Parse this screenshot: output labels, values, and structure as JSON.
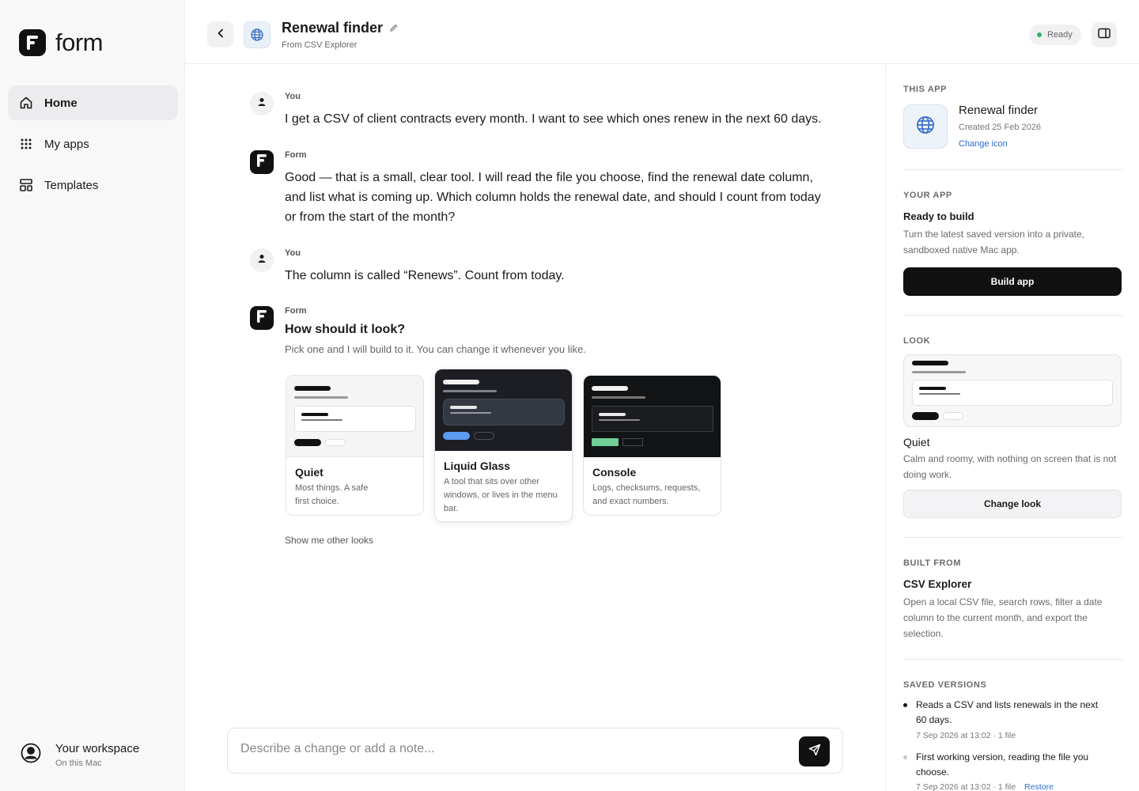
{
  "app": {
    "name": "form"
  },
  "sidebar": {
    "items": [
      {
        "label": "Home",
        "icon": "home-icon",
        "active": true
      },
      {
        "label": "My apps",
        "icon": "grid-icon",
        "active": false
      },
      {
        "label": "Templates",
        "icon": "templates-icon",
        "active": false
      }
    ],
    "workspace": {
      "title": "Your workspace",
      "subtitle": "On this Mac"
    }
  },
  "header": {
    "title": "Renewal finder",
    "subtitle": "From CSV Explorer",
    "status": "Ready",
    "status_color": "#2fb36b"
  },
  "chat": {
    "messages": [
      {
        "author": "You",
        "text": "I get a CSV of client contracts every month. I want to see which ones renew in the next 60 days."
      },
      {
        "author": "Form",
        "text": "Good — that is a small, clear tool. I will read the file you choose, find the renewal date column, and list what is coming up. Which column holds the renewal date, and should I count from today or from the start of the month?"
      },
      {
        "author": "You",
        "text": "The column is called “Renews”. Count from today."
      },
      {
        "author": "Form",
        "title": "How should it look?",
        "text": "Pick one and I will build to it. You can change it whenever you like."
      }
    ],
    "looks": [
      {
        "name": "Quiet",
        "description": "Most things. A safe first choice."
      },
      {
        "name": "Liquid Glass",
        "description": "A tool that sits over other windows, or lives in the menu bar."
      },
      {
        "name": "Console",
        "description": "Logs, checksums, requests, and exact numbers."
      }
    ],
    "show_other": "Show me other looks"
  },
  "composer": {
    "placeholder": "Describe a change or add a note..."
  },
  "panel": {
    "this_app": {
      "label": "THIS APP",
      "name": "Renewal finder",
      "created": "Created 25 Feb 2026",
      "change_icon": "Change icon"
    },
    "your_app": {
      "label": "YOUR APP",
      "title": "Ready to build",
      "description": "Turn the latest saved version into a private, sandboxed native Mac app.",
      "button": "Build app"
    },
    "look": {
      "label": "LOOK",
      "name": "Quiet",
      "description": "Calm and roomy, with nothing on screen that is not doing work.",
      "button": "Change look"
    },
    "built_from": {
      "label": "BUILT FROM",
      "name": "CSV Explorer",
      "description": "Open a local CSV file, search rows, filter a date column to the current month, and export the selection."
    },
    "saved_versions": {
      "label": "SAVED VERSIONS",
      "items": [
        {
          "title": "Reads a CSV and lists renewals in the next 60 days.",
          "meta": "7 Sep 2026 at 13:02 · 1 file"
        },
        {
          "title": "First working version, reading the file you choose.",
          "meta": "7 Sep 2026 at 13:02 · 1 file",
          "action": "Restore"
        }
      ]
    }
  },
  "colors": {
    "accent_link": "#2b6cd6",
    "console_green": "#6fcf97",
    "glass_blue": "#5b9bf2"
  }
}
